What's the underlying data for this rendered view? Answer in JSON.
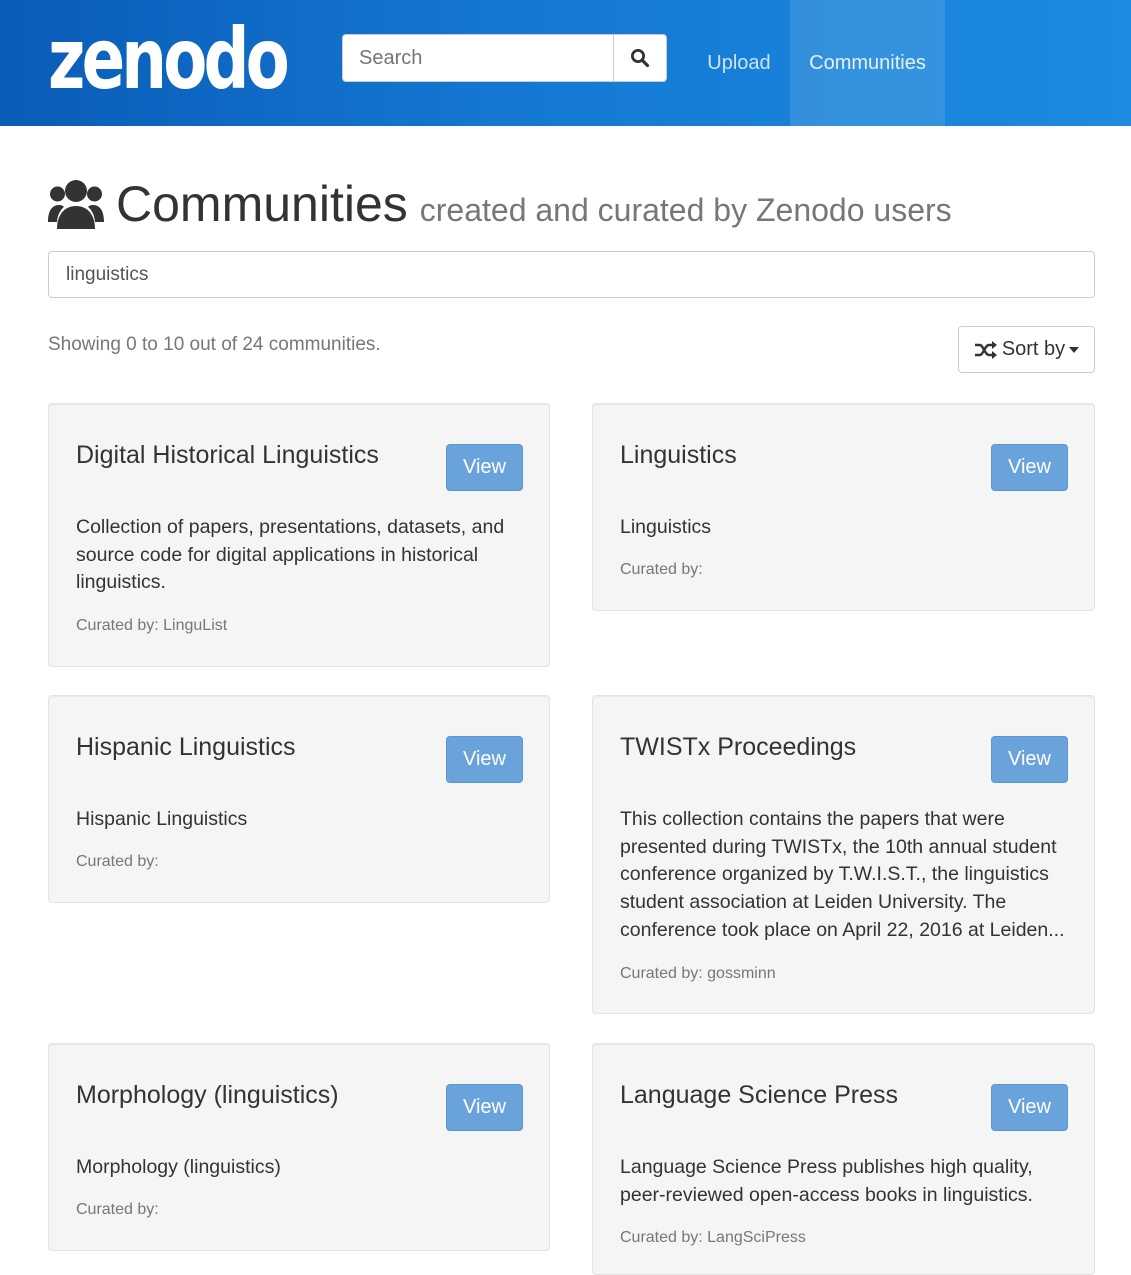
{
  "header": {
    "logo_text": "zenodo",
    "search_placeholder": "Search",
    "nav": {
      "upload": "Upload",
      "communities": "Communities"
    },
    "icons": {
      "search": "search-icon"
    },
    "colors": {
      "bar_start": "#0a5cb8",
      "bar_end": "#1c8be0"
    }
  },
  "page": {
    "title": "Communities",
    "subtitle": "created and curated by Zenodo users",
    "title_icon": "users-icon",
    "filter_value": "linguistics",
    "showing_text": "Showing 0 to 10 out of 24 communities.",
    "sort_label": "Sort by",
    "sort_icon": "random-icon"
  },
  "communities": [
    {
      "title": "Digital Historical Linguistics",
      "view_label": "View",
      "description": "Collection of papers, presentations, datasets, and source code for digital applications in historical linguistics.",
      "curated": "Curated by: LinguList"
    },
    {
      "title": "Linguistics",
      "view_label": "View",
      "description": "Linguistics",
      "curated": "Curated by:"
    },
    {
      "title": "Hispanic Linguistics",
      "view_label": "View",
      "description": "Hispanic Linguistics",
      "curated": "Curated by:"
    },
    {
      "title": "TWISTx Proceedings",
      "view_label": "View",
      "description": "This collection contains the papers that were presented during TWISTx, the 10th annual student conference organized by T.W.I.S.T., the linguistics student association at Leiden University. The conference took place on April 22, 2016 at Leiden...",
      "curated": "Curated by: gossminn"
    },
    {
      "title": "Morphology (linguistics)",
      "view_label": "View",
      "description": "Morphology (linguistics)",
      "curated": "Curated by:"
    },
    {
      "title": "Language Science Press",
      "view_label": "View",
      "description": "Language Science Press publishes high quality, peer-reviewed open-access books in linguistics.",
      "curated": "Curated by: LangSciPress"
    }
  ]
}
